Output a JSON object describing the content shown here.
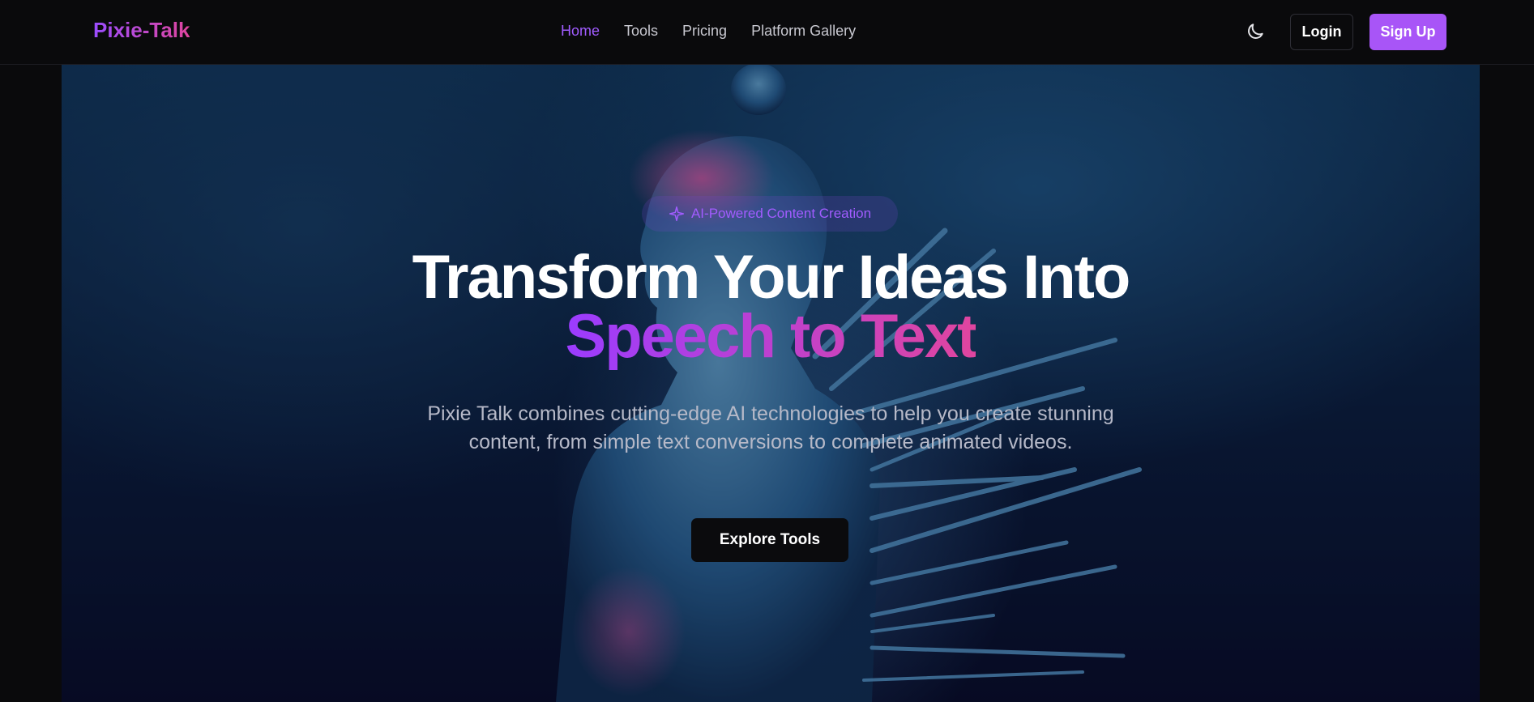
{
  "nav": {
    "logo": "Pixie-Talk",
    "links": [
      "Home",
      "Tools",
      "Pricing",
      "Platform Gallery"
    ],
    "active": "Home",
    "theme_icon": "moon-icon",
    "login_label": "Login",
    "signup_label": "Sign Up"
  },
  "hero": {
    "badge_icon": "sparkle-icon",
    "badge_text": "AI-Powered Content Creation",
    "title_line1": "Transform Your Ideas Into",
    "title_line2": "Speech to Text",
    "subtitle": "Pixie Talk combines cutting-edge AI technologies to help you create stunning content, from simple text conversions to complete animated videos.",
    "cta_label": "Explore Tools"
  },
  "colors": {
    "accent": "#a855f7",
    "gradient_start": "#9b3cff",
    "gradient_end": "#e0459f",
    "background": "#0a0a0c"
  }
}
